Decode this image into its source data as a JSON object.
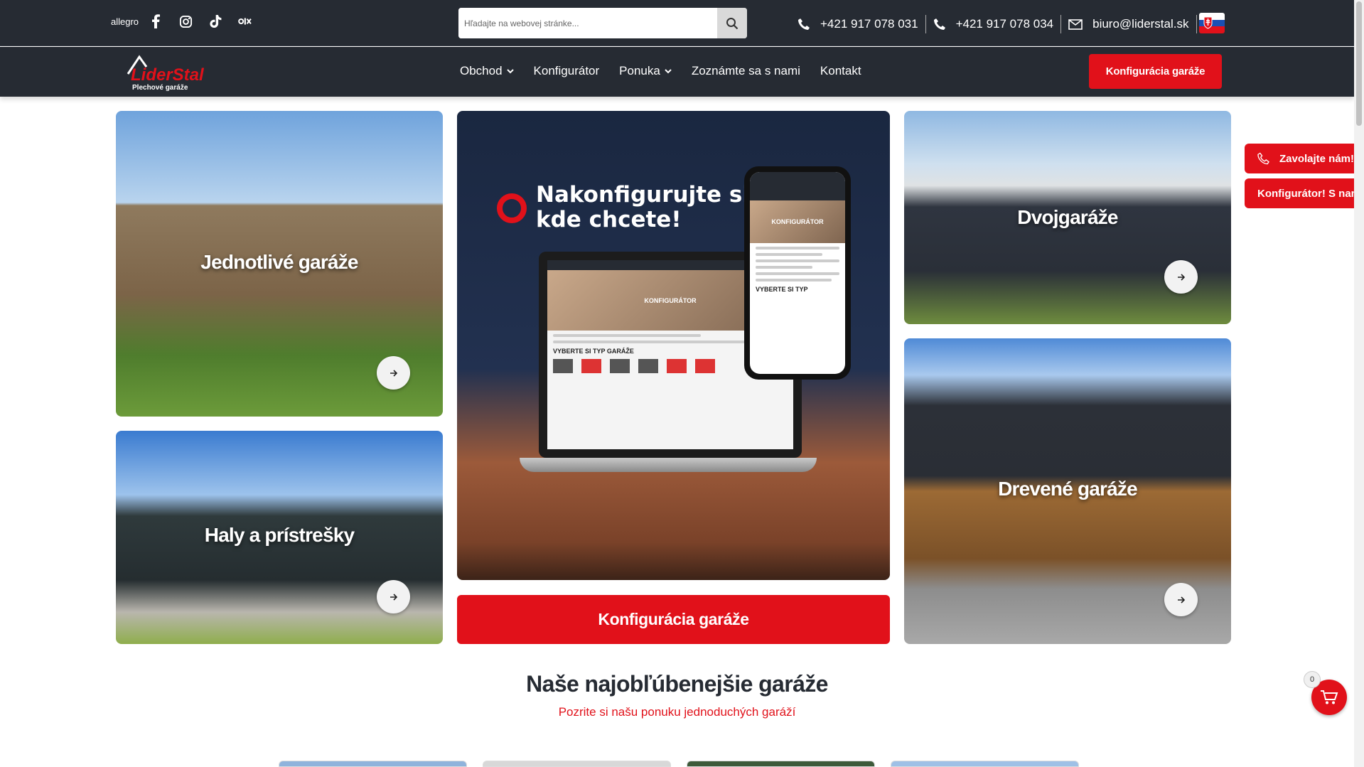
{
  "topbar": {
    "social": {
      "allegro": "allegro",
      "icons": [
        "facebook-icon",
        "instagram-icon",
        "tiktok-icon",
        "olx-icon"
      ]
    },
    "search_placeholder": "Hľadajte na webovej stránke...",
    "phone1": "+421 917 078 031",
    "phone2": "+421 917 078 034",
    "email": "biuro@liderstal.sk",
    "language_flag": "sk-flag-icon"
  },
  "navbar": {
    "logo_text": "LiderStal",
    "logo_tagline": "Plechové garáže",
    "menu": [
      {
        "label": "Obchod",
        "dropdown": true
      },
      {
        "label": "Konfigurátor",
        "dropdown": false
      },
      {
        "label": "Ponuka",
        "dropdown": true
      },
      {
        "label": "Zoznámte sa s nami",
        "dropdown": false
      },
      {
        "label": "Kontakt",
        "dropdown": false
      }
    ],
    "cta": "Konfigurácia garáže"
  },
  "tiles": {
    "single": "Jednotlivé garáže",
    "halls": "Haly a prístrešky",
    "double": "Dvojgaráže",
    "wooden": "Drevené garáže"
  },
  "configurator": {
    "headline_line1": "Nakonfigurujte si",
    "headline_line2": "kde chcete!",
    "phone_screen_label": "KONFIGURÁTOR",
    "phone_screen_footer": "VYBERTE SI TYP",
    "laptop_screen_label": "KONFIGURÁTOR",
    "laptop_screen_footer": "VYBERTE SI TYP GARÁŽE",
    "button": "Konfigurácia garáže"
  },
  "section": {
    "title": "Naše najobľúbenejšie garáže",
    "subtitle": "Pozrite si našu ponuku jednoduchých garáží"
  },
  "floating": {
    "call": "Zavolajte nám!",
    "configurator": "Konfigurátor!  S nami",
    "cart_count": "0"
  },
  "colors": {
    "brand_red": "#e1111a",
    "dark": "#262b33"
  }
}
